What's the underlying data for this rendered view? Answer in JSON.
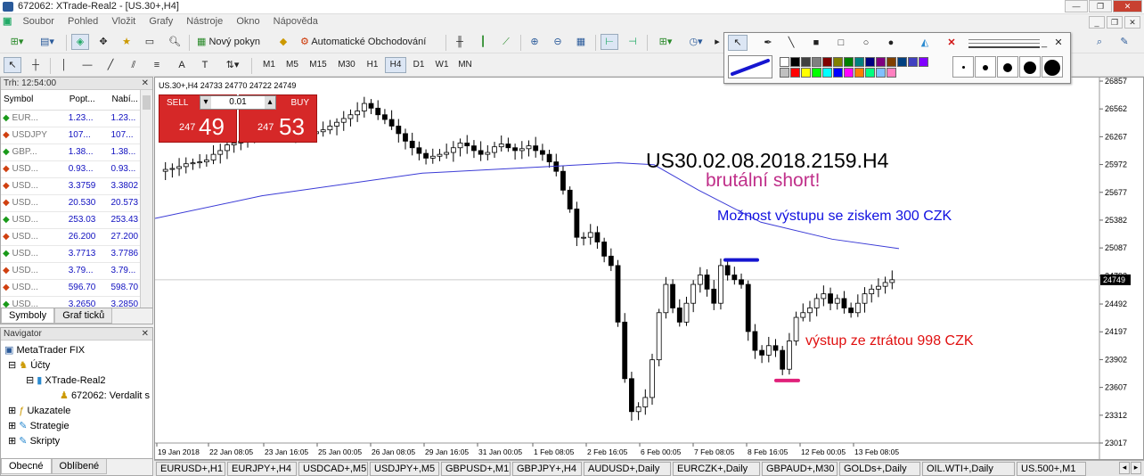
{
  "window": {
    "title": "672062: XTrade-Real2 - [US.30+,H4]"
  },
  "menu": [
    "Soubor",
    "Pohled",
    "Vložit",
    "Grafy",
    "Nástroje",
    "Okno",
    "Nápověda"
  ],
  "toolbar": {
    "new_order": "Nový pokyn",
    "auto_trading": "Automatické Obchodování"
  },
  "timeframes": [
    "M1",
    "M5",
    "M15",
    "M30",
    "H1",
    "H4",
    "D1",
    "W1",
    "MN"
  ],
  "active_timeframe": "H4",
  "market_watch": {
    "header": "Trh: 12:54:00",
    "columns": [
      "Symbol",
      "Popt...",
      "Nabí..."
    ],
    "rows": [
      {
        "symbol": "EUR...",
        "bid": "1.23...",
        "ask": "1.23...",
        "dir": "up"
      },
      {
        "symbol": "USDJPY",
        "bid": "107...",
        "ask": "107...",
        "dir": "down"
      },
      {
        "symbol": "GBP...",
        "bid": "1.38...",
        "ask": "1.38...",
        "dir": "up"
      },
      {
        "symbol": "USD...",
        "bid": "0.93...",
        "ask": "0.93...",
        "dir": "down"
      },
      {
        "symbol": "USD...",
        "bid": "3.3759",
        "ask": "3.3802",
        "dir": "down"
      },
      {
        "symbol": "USD...",
        "bid": "20.530",
        "ask": "20.573",
        "dir": "down"
      },
      {
        "symbol": "USD...",
        "bid": "253.03",
        "ask": "253.43",
        "dir": "up"
      },
      {
        "symbol": "USD...",
        "bid": "26.200",
        "ask": "27.200",
        "dir": "down"
      },
      {
        "symbol": "USD...",
        "bid": "3.7713",
        "ask": "3.7786",
        "dir": "up"
      },
      {
        "symbol": "USD...",
        "bid": "3.79...",
        "ask": "3.79...",
        "dir": "down"
      },
      {
        "symbol": "USD...",
        "bid": "596.70",
        "ask": "598.70",
        "dir": "down"
      },
      {
        "symbol": "USD...",
        "bid": "3.2650",
        "ask": "3.2850",
        "dir": "up"
      }
    ],
    "tabs": [
      "Symboly",
      "Graf ticků"
    ]
  },
  "navigator": {
    "header": "Navigator",
    "items": [
      "MetaTrader FIX",
      "Účty",
      "XTrade-Real2",
      "672062: Verdalit s",
      "Ukazatele",
      "Strategie",
      "Skripty"
    ],
    "tabs": [
      "Obecné",
      "Oblíbené"
    ]
  },
  "chart": {
    "label": "US.30+,H4  24733 24770 24722 24749",
    "sell": "SELL",
    "buy": "BUY",
    "lot": "0.01",
    "sell_small": "247",
    "sell_big": "49",
    "buy_small": "247",
    "buy_big": "53",
    "price_scale": [
      "26857",
      "26562",
      "26267",
      "25972",
      "25677",
      "25382",
      "25087",
      "24792",
      "24492",
      "24197",
      "23902",
      "23607",
      "23312",
      "23017"
    ],
    "current_price": "24749",
    "time_scale": [
      "19 Jan 2018",
      "22 Jan 08:05",
      "23 Jan 16:05",
      "25 Jan 00:05",
      "26 Jan 08:05",
      "29 Jan 16:05",
      "31 Jan 00:05",
      "1 Feb 08:05",
      "2 Feb 16:05",
      "6 Feb 00:05",
      "7 Feb 08:05",
      "8 Feb 16:05",
      "12 Feb 00:05",
      "13 Feb 08:05"
    ],
    "annotations": {
      "title": "US30.02.08.2018.2159.H4",
      "subtitle": "brutální short!",
      "profit": "Možnost výstupu se ziskem 300 CZK",
      "loss": "výstup ze ztrátou 998 CZK"
    },
    "colors": {
      "ma": "#3b3bd6",
      "title": "#000000",
      "subtitle": "#c0308a",
      "profit": "#1010e0",
      "loss": "#e01010",
      "profit_line": "#1515d0",
      "loss_line": "#e0207a"
    }
  },
  "bottom_tabs": [
    "EURUSD+,H1",
    "EURJPY+,H4",
    "USDCAD+,M5",
    "USDJPY+,M5",
    "GBPUSD+,M1",
    "GBPJPY+,H4",
    "AUDUSD+,Daily",
    "EURCZK+,Daily",
    "GBPAUD+,M30",
    "GOLDs+,Daily",
    "OIL.WTI+,Daily",
    "US.500+,M1"
  ],
  "palette": [
    "#ffffff",
    "#000000",
    "#404040",
    "#808080",
    "#800000",
    "#808000",
    "#008000",
    "#008080",
    "#000080",
    "#800080",
    "#804000",
    "#004080",
    "#4040c0",
    "#8000ff",
    "#c0c0c0",
    "#ff0000",
    "#ffff00",
    "#00ff00",
    "#00ffff",
    "#0000ff",
    "#ff00ff",
    "#ff8000",
    "#00ff80",
    "#80c0ff",
    "#ff80c0"
  ]
}
